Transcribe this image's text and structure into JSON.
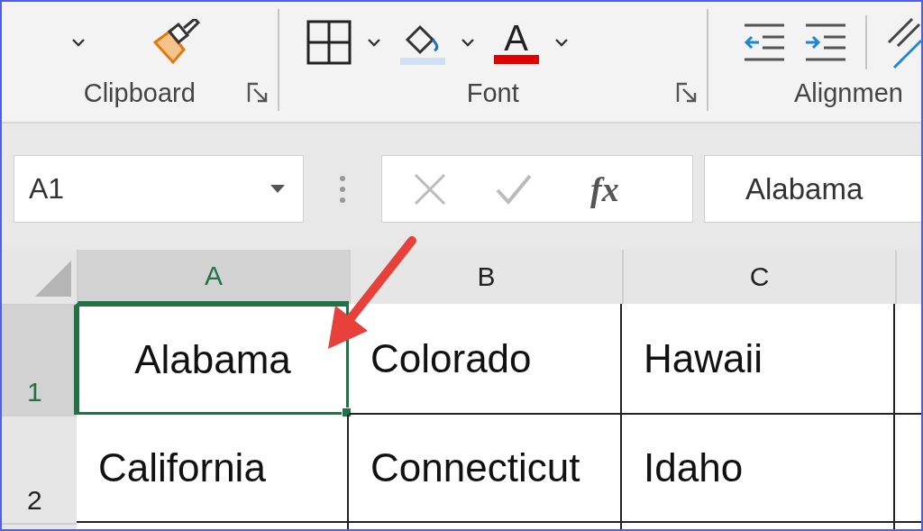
{
  "ribbon": {
    "groups": [
      {
        "label": "Clipboard",
        "launcher": true
      },
      {
        "label": "Font",
        "launcher": true
      },
      {
        "label": "Alignmen",
        "launcher": false
      }
    ],
    "font_color_letter": "A"
  },
  "formula_bar": {
    "name_box": "A1",
    "fx": "fx",
    "value": "Alabama"
  },
  "sheet": {
    "columns": [
      {
        "label": "A",
        "selected": true
      },
      {
        "label": "B",
        "selected": false
      },
      {
        "label": "C",
        "selected": false
      }
    ],
    "rows": [
      {
        "number": "1",
        "selected": true,
        "cells": [
          {
            "text": "Alabama",
            "selected": true,
            "kind": "centered"
          },
          {
            "text": "Colorado",
            "selected": false,
            "kind": "plain"
          },
          {
            "text": "Hawaii",
            "selected": false,
            "kind": "plain"
          }
        ]
      },
      {
        "number": "2",
        "selected": false,
        "cells": [
          {
            "text": "California",
            "selected": false,
            "kind": "plain"
          },
          {
            "text": "Connecticut",
            "selected": false,
            "kind": "plain"
          },
          {
            "text": "Idaho",
            "selected": false,
            "kind": "plain"
          }
        ]
      }
    ]
  }
}
